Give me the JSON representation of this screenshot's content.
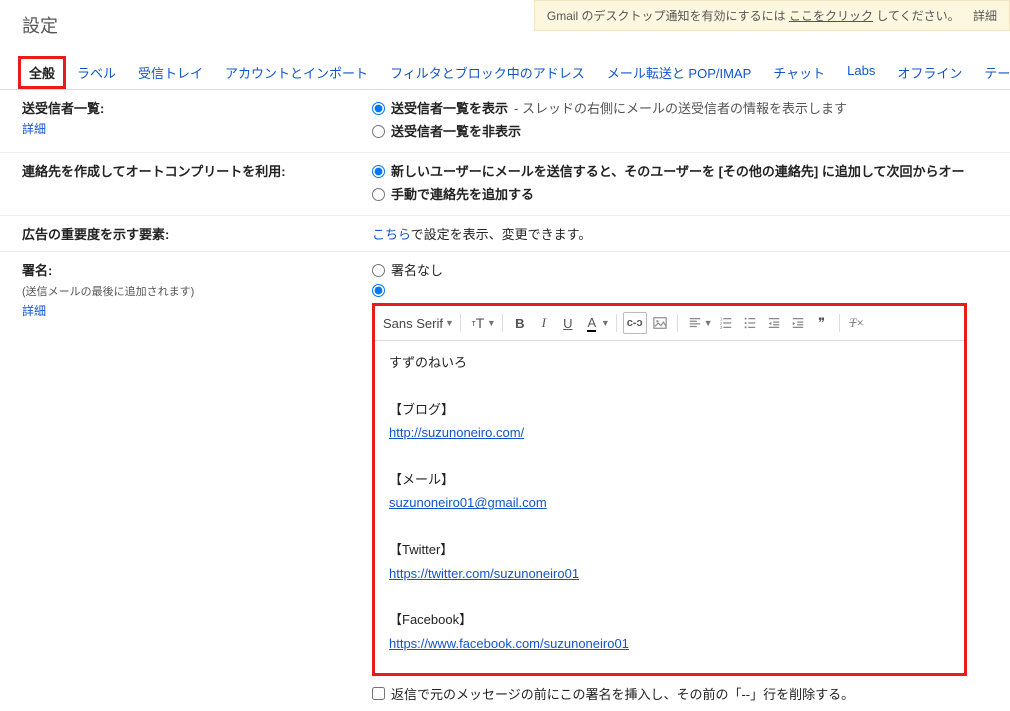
{
  "notice": {
    "prefix": "Gmail のデスクトップ通知を有効にするには",
    "link": "ここをクリック",
    "suffix": "してください。",
    "detail": "詳細"
  },
  "page": {
    "title": "設定"
  },
  "tabs": {
    "general": "全般",
    "labels": "ラベル",
    "inbox": "受信トレイ",
    "accounts": "アカウントとインポート",
    "filters": "フィルタとブロック中のアドレス",
    "forwarding": "メール転送と POP/IMAP",
    "chat": "チャット",
    "labs": "Labs",
    "offline": "オフライン",
    "more": "テー"
  },
  "senders": {
    "label": "送受信者一覧:",
    "detail": "詳細",
    "opt_show_label": "送受信者一覧を表示",
    "opt_show_desc": " - スレッドの右側にメールの送受信者の情報を表示します",
    "opt_hide_label": "送受信者一覧を非表示"
  },
  "contacts": {
    "label": "連絡先を作成してオートコンプリートを利用:",
    "opt_auto": "新しいユーザーにメールを送信すると、そのユーザーを [その他の連絡先] に追加して次回からオー",
    "opt_manual": "手動で連絡先を追加する"
  },
  "ads": {
    "label": "広告の重要度を示す要素:",
    "link": "こちら",
    "desc": "で設定を表示、変更できます。"
  },
  "signature": {
    "label": "署名:",
    "note": "(送信メールの最後に追加されます)",
    "detail": "詳細",
    "opt_none": "署名なし",
    "font_name": "Sans Serif",
    "size_icons": {
      "small": "т",
      "large": "T"
    },
    "content": {
      "line1": "すずのねいろ",
      "blog_label": "【ブログ】",
      "blog_url": "http://suzunoneiro.com/",
      "mail_label": "【メール】",
      "mail_addr": "suzunoneiro01@gmail.com",
      "twitter_label": "【Twitter】",
      "twitter_url": "https://twitter.com/suzunoneiro01",
      "facebook_label": "【Facebook】",
      "facebook_url": "https://www.facebook.com/suzunoneiro01"
    },
    "reply_checkbox": "返信で元のメッセージの前にこの署名を挿入し、その前の「--」行を削除する。"
  },
  "toolbar_labels": {
    "bold": "B",
    "italic": "I",
    "underline": "U",
    "text_color": "A",
    "link": "⊂⊃",
    "quote": "❞"
  }
}
